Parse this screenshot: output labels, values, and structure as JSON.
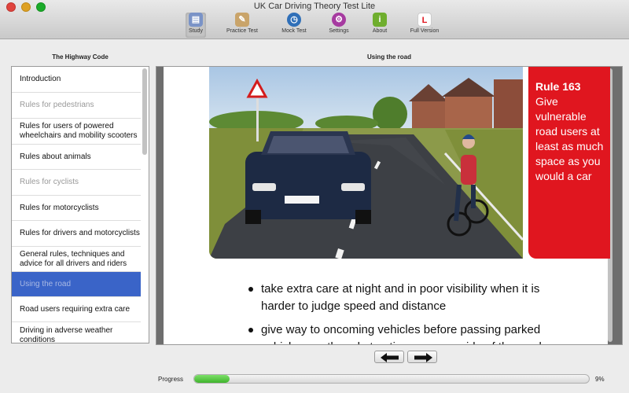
{
  "window": {
    "title": "UK Car Driving Theory Test Lite"
  },
  "toolbar": {
    "items": [
      {
        "label": "Study",
        "icon": "book-icon",
        "color": "#7a93c7",
        "glyph": "▤"
      },
      {
        "label": "Practice Test",
        "icon": "clipboard-icon",
        "color": "#c9a46a",
        "glyph": "✎"
      },
      {
        "label": "Mock Test",
        "icon": "stopwatch-icon",
        "color": "#2f6fb8",
        "glyph": "◷"
      },
      {
        "label": "Settings",
        "icon": "gear-icon",
        "color": "#a63aa0",
        "glyph": "⚙"
      },
      {
        "label": "About",
        "icon": "info-icon",
        "color": "#6fae2e",
        "glyph": "i"
      },
      {
        "label": "Full Version",
        "icon": "learner-plate-icon",
        "color": "#e0161f",
        "glyph": "L"
      }
    ]
  },
  "sidebar": {
    "heading": "The Highway Code",
    "items": [
      {
        "label": "Introduction",
        "state": "normal"
      },
      {
        "label": "Rules for pedestrians",
        "state": "dim"
      },
      {
        "label": "Rules for users of powered wheelchairs and mobility scooters",
        "state": "normal"
      },
      {
        "label": "Rules about animals",
        "state": "normal"
      },
      {
        "label": "Rules for cyclists",
        "state": "dim"
      },
      {
        "label": "Rules for motorcyclists",
        "state": "normal"
      },
      {
        "label": "Rules for drivers and motorcyclists",
        "state": "normal"
      },
      {
        "label": "General rules, techniques and advice for all drivers and riders",
        "state": "normal"
      },
      {
        "label": "Using the road",
        "state": "selected"
      },
      {
        "label": "Road users requiring extra care",
        "state": "normal"
      },
      {
        "label": "Driving in adverse weather conditions",
        "state": "normal"
      }
    ]
  },
  "content": {
    "heading": "Using the road",
    "rule": {
      "title": "Rule 163",
      "text": "Give vulnerable road users at least as much space as you would a car"
    },
    "bullets": [
      "take extra care at night and in poor visibility when it is harder to judge speed and distance",
      "give way to oncoming vehicles before passing parked vehicles or other obstructions on your side of the road"
    ]
  },
  "nav": {
    "prev_icon": "arrow-left-icon",
    "next_icon": "arrow-right-icon"
  },
  "progress": {
    "label": "Progress",
    "value": 9,
    "display": "9%"
  },
  "colors": {
    "accent": "#3a64c8",
    "rule_red": "#e0161f",
    "progress_green": "#4cc238"
  }
}
